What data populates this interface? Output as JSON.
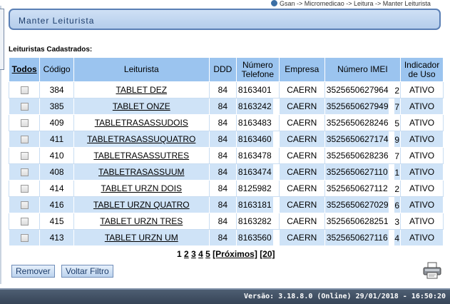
{
  "breadcrumb": "Gsan -> Micromedicao -> Leitura -> Manter Leiturista",
  "title": "Manter Leiturista",
  "section_label": "Leituristas Cadastrados:",
  "columns": {
    "todos": "Todos",
    "codigo": "Código",
    "leiturista": "Leiturista",
    "ddd": "DDD",
    "telefone": "Número Telefone",
    "empresa": "Empresa",
    "imei": "Número IMEI",
    "indicador": "Indicador de Uso"
  },
  "rows": [
    {
      "codigo": "384",
      "leiturista": "TABLET DEZ",
      "ddd": "84",
      "telefone": "8163401",
      "empresa": "CAERN",
      "imei": "3525650627964",
      "imei_end": "2",
      "indicador": "ATIVO"
    },
    {
      "codigo": "385",
      "leiturista": "TABLET ONZE",
      "ddd": "84",
      "telefone": "8163242",
      "empresa": "CAERN",
      "imei": "3525650627949",
      "imei_end": "7",
      "indicador": "ATIVO"
    },
    {
      "codigo": "409",
      "leiturista": "TABLETRASASSUDOIS",
      "ddd": "84",
      "telefone": "8163483",
      "empresa": "CAERN",
      "imei": "3525650628246",
      "imei_end": "5",
      "indicador": "ATIVO"
    },
    {
      "codigo": "411",
      "leiturista": "TABLETRASASSUQUATRO",
      "ddd": "84",
      "telefone": "8163460",
      "empresa": "CAERN",
      "imei": "3525650627174",
      "imei_end": "9",
      "indicador": "ATIVO"
    },
    {
      "codigo": "410",
      "leiturista": "TABLETRASASSUTRES",
      "ddd": "84",
      "telefone": "8163478",
      "empresa": "CAERN",
      "imei": "3525650628236",
      "imei_end": "7",
      "indicador": "ATIVO"
    },
    {
      "codigo": "408",
      "leiturista": "TABLETRASASSUUM",
      "ddd": "84",
      "telefone": "8163474",
      "empresa": "CAERN",
      "imei": "3525650627110",
      "imei_end": "1",
      "indicador": "ATIVO"
    },
    {
      "codigo": "414",
      "leiturista": "TABLET URZN DOIS",
      "ddd": "84",
      "telefone": "8125982",
      "empresa": "CAERN",
      "imei": "3525650627112",
      "imei_end": "2",
      "indicador": "ATIVO"
    },
    {
      "codigo": "416",
      "leiturista": "TABLET URZN QUATRO",
      "ddd": "84",
      "telefone": "8163181",
      "empresa": "CAERN",
      "imei": "3525650627029",
      "imei_end": "6",
      "indicador": "ATIVO"
    },
    {
      "codigo": "415",
      "leiturista": "TABLET URZN TRES",
      "ddd": "84",
      "telefone": "8163282",
      "empresa": "CAERN",
      "imei": "3525650628251",
      "imei_end": "3",
      "indicador": "ATIVO"
    },
    {
      "codigo": "413",
      "leiturista": "TABLET URZN UM",
      "ddd": "84",
      "telefone": "8163560",
      "empresa": "CAERN",
      "imei": "3525650627116",
      "imei_end": "4",
      "indicador": "ATIVO"
    }
  ],
  "pager": {
    "pages": [
      "1",
      "2",
      "3",
      "4",
      "5"
    ],
    "next": "[Próximos]",
    "last": "[20]"
  },
  "buttons": {
    "remover": "Remover",
    "voltar": "Voltar Filtro"
  },
  "footer": "Versão: 3.18.8.0 (Online) 29/01/2018 - 16:50:20",
  "icons": {
    "breadcrumb": "globe-icon",
    "print": "printer-icon"
  },
  "colors": {
    "header_bg": "#9bc4ef",
    "row_even": "#cfe3f7",
    "footer_bg": "#3e4d61"
  }
}
